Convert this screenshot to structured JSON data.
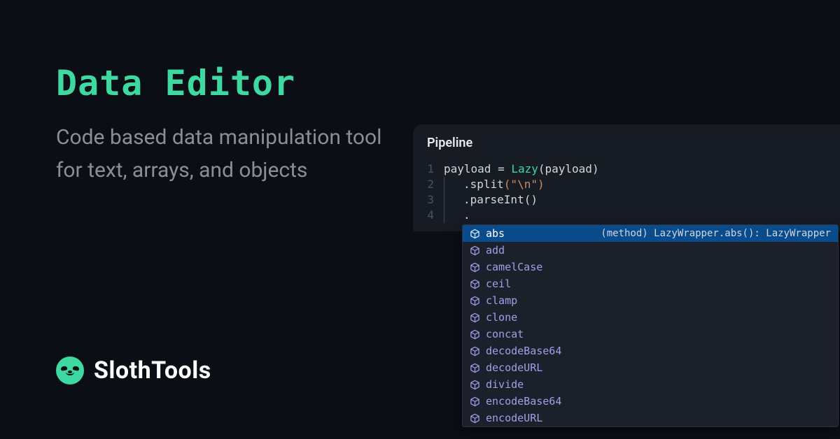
{
  "hero": {
    "title": "Data Editor",
    "subtitle": "Code based data manipulation tool for text, arrays, and objects"
  },
  "brand": {
    "name": "SlothTools"
  },
  "editor": {
    "panel_title": "Pipeline",
    "lines": {
      "n1": "1",
      "n2": "2",
      "n3": "3",
      "n4": "4",
      "l1_var": "payload",
      "l1_op": " = ",
      "l1_cls": "Lazy",
      "l1_rest": "(payload)",
      "l2_fn": ".split",
      "l2_arg": "(\"\\n\")",
      "l3_fn": ".parseInt",
      "l3_rest": "()",
      "l4_dot": "."
    },
    "autocomplete": {
      "selected_hint": "(method) LazyWrapper.abs(): LazyWrapper",
      "items": [
        {
          "label": "abs",
          "selected": true
        },
        {
          "label": "add"
        },
        {
          "label": "camelCase"
        },
        {
          "label": "ceil"
        },
        {
          "label": "clamp"
        },
        {
          "label": "clone"
        },
        {
          "label": "concat"
        },
        {
          "label": "decodeBase64"
        },
        {
          "label": "decodeURL"
        },
        {
          "label": "divide"
        },
        {
          "label": "encodeBase64"
        },
        {
          "label": "encodeURL"
        }
      ]
    }
  }
}
